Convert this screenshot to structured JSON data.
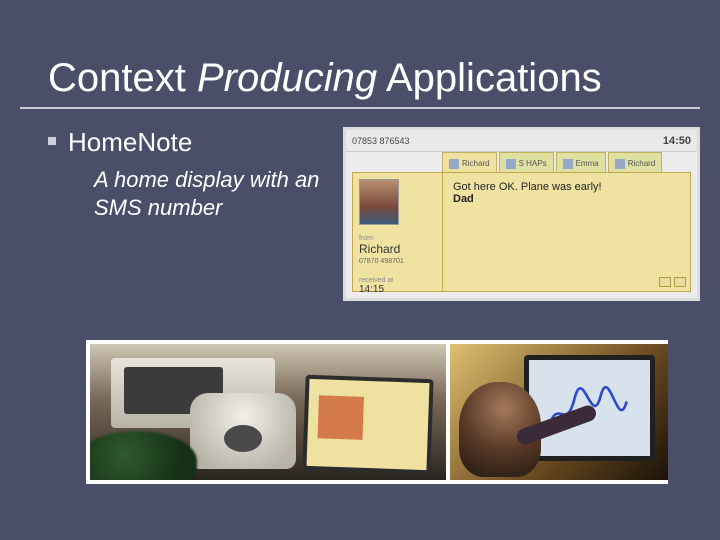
{
  "title": {
    "part1": "Context ",
    "emph": "Producing",
    "part3": " Applications"
  },
  "bullet": {
    "heading": "HomeNote",
    "description": "A home display with an SMS number"
  },
  "mock": {
    "phone_number": "07853 876543",
    "clock": "14:50",
    "tabs": [
      "Richard",
      "S HAPs",
      "Emma",
      "Richard"
    ],
    "sender": {
      "from_label": "from",
      "name": "Richard",
      "phone": "07870 498701",
      "received_label": "received at",
      "time": "14:15"
    },
    "message": {
      "line1": "Got here OK. Plane was early!",
      "line2": "Dad"
    }
  }
}
